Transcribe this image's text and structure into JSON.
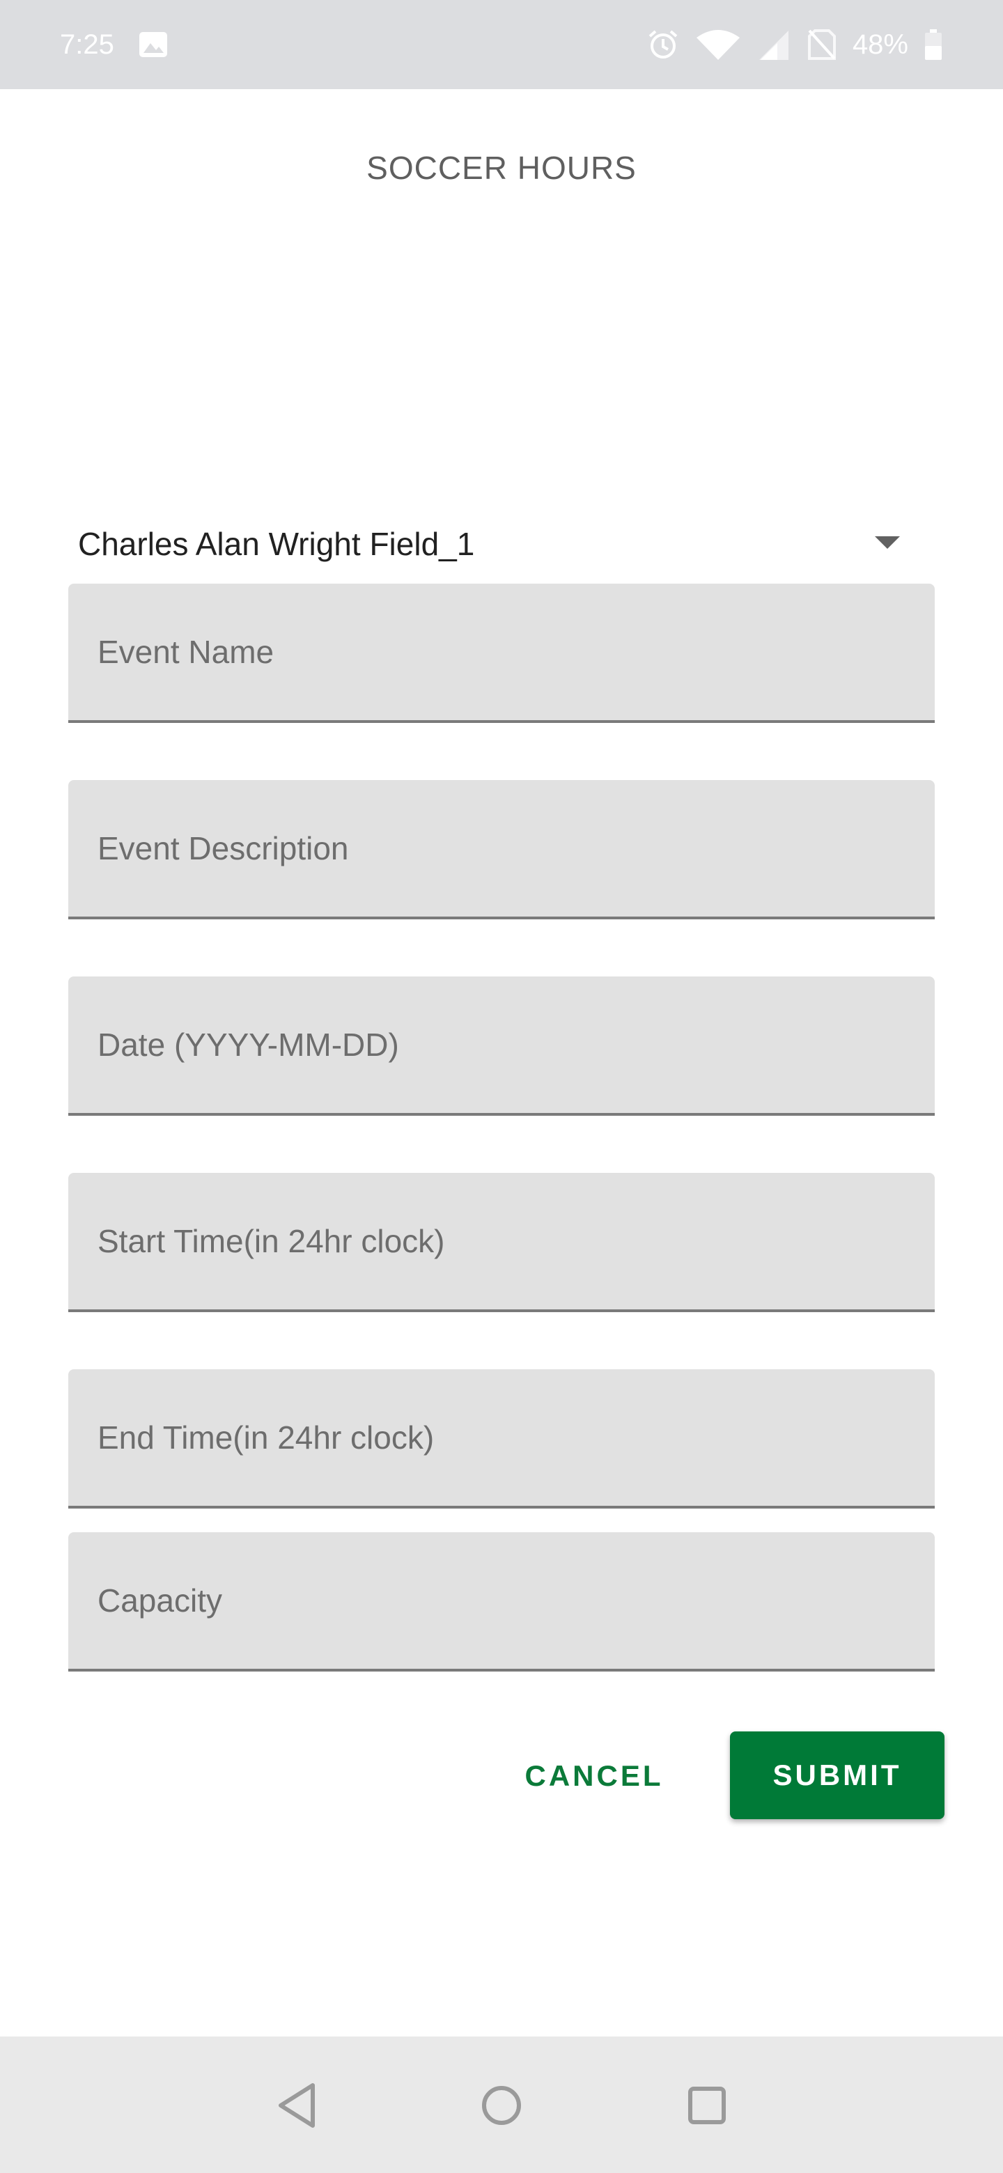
{
  "status_bar": {
    "time": "7:25",
    "battery_text": "48%",
    "icons": [
      "gallery-icon",
      "alarm-icon",
      "wifi-icon",
      "signal-icon",
      "no-sim-icon",
      "battery-icon"
    ]
  },
  "page": {
    "title": "SOCCER HOURS"
  },
  "venue_select": {
    "selected": "Charles Alan Wright Field_1",
    "icon": "dropdown-arrow-icon"
  },
  "form": {
    "event_name": {
      "placeholder": "Event Name",
      "value": ""
    },
    "event_description": {
      "placeholder": "Event Description",
      "value": ""
    },
    "date": {
      "placeholder": "Date (YYYY-MM-DD)",
      "value": ""
    },
    "start_time": {
      "placeholder": "Start Time(in 24hr clock)",
      "value": ""
    },
    "end_time": {
      "placeholder": "End Time(in 24hr clock)",
      "value": ""
    },
    "capacity": {
      "placeholder": "Capacity",
      "value": ""
    }
  },
  "actions": {
    "cancel_label": "CANCEL",
    "submit_label": "SUBMIT"
  },
  "colors": {
    "accent_green": "#007a37",
    "status_bar": "#dcdde0",
    "field_background": "#e1e1e1",
    "nav_bar": "#e9e9e9"
  },
  "nav_bar": {
    "icons": [
      "back-icon",
      "home-icon",
      "recents-icon"
    ]
  }
}
